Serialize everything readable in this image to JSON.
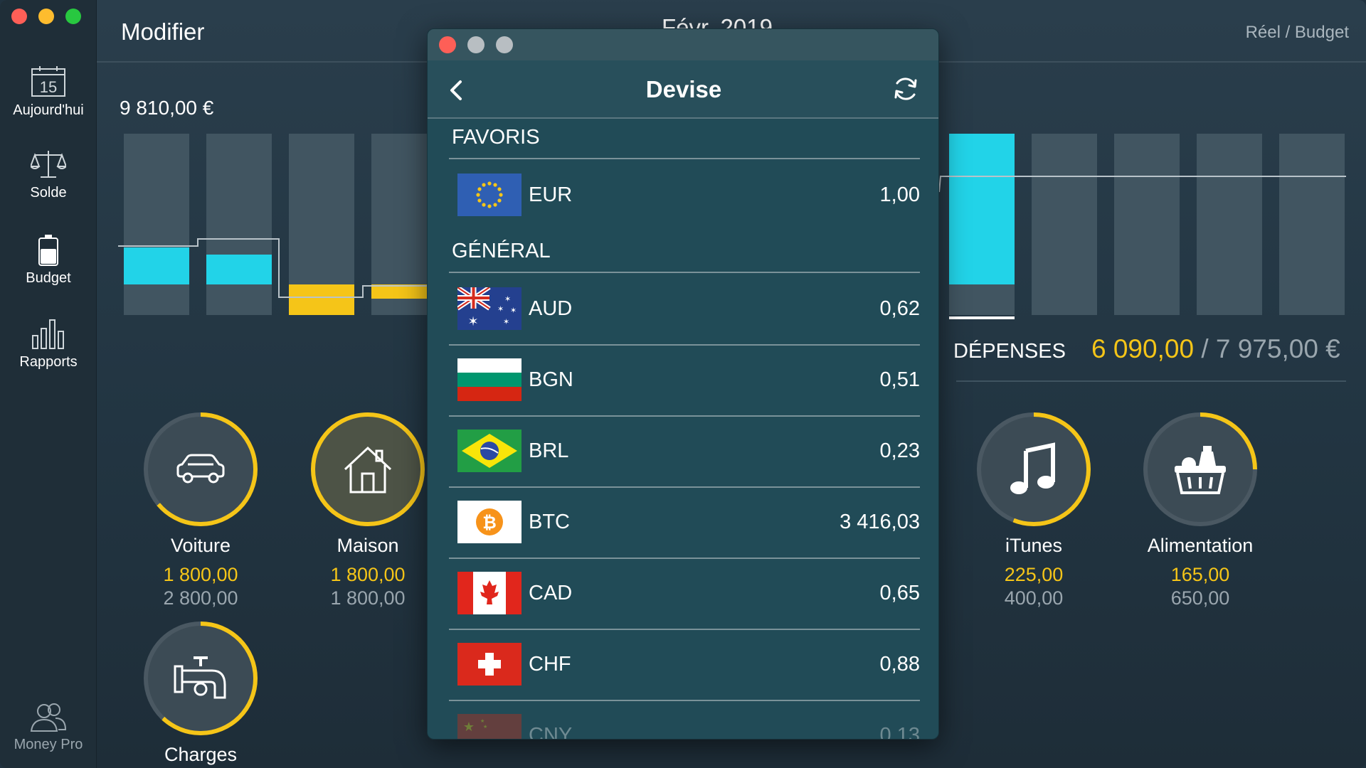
{
  "window": {
    "traffic_lights": [
      "#fe5f57",
      "#febc2e",
      "#28c840"
    ]
  },
  "sidebar": {
    "items": [
      {
        "label": "Aujourd'hui",
        "icon": "calendar-icon",
        "day": "15"
      },
      {
        "label": "Solde",
        "icon": "scale-icon"
      },
      {
        "label": "Budget",
        "icon": "battery-icon"
      },
      {
        "label": "Rapports",
        "icon": "bar-chart-icon"
      }
    ],
    "footer": {
      "label": "Money Pro",
      "icon": "users-icon"
    }
  },
  "header": {
    "title": "Modifier",
    "month": "Févr. 2019",
    "view_toggle": "Réel / Budget"
  },
  "summary": {
    "balance": "9 810,00 €",
    "expenses_label": "DÉPENSES",
    "expenses_spent": "6 090,00",
    "expenses_budget": "/ 7 975,00 €"
  },
  "colors": {
    "accent_yellow": "#f5c518",
    "accent_cyan": "#22d3e8",
    "bar_bg": "#415561"
  },
  "categories": [
    {
      "name": "Voiture",
      "spent": "1 800,00",
      "budget": "2 800,00",
      "icon": "car-icon",
      "progress": 0.64
    },
    {
      "name": "Maison",
      "spent": "1 800,00",
      "budget": "1 800,00",
      "icon": "house-icon",
      "progress": 1.0
    },
    {
      "name": "iTunes",
      "spent": "225,00",
      "budget": "400,00",
      "icon": "music-note-icon",
      "progress": 0.56
    },
    {
      "name": "Alimentation",
      "spent": "165,00",
      "budget": "650,00",
      "icon": "grocery-basket-icon",
      "progress": 0.25
    },
    {
      "name": "Charges",
      "spent": "",
      "budget": "",
      "icon": "water-tap-icon",
      "progress": 0.62
    }
  ],
  "modal": {
    "title": "Devise",
    "back_icon": "chevron-left-icon",
    "refresh_icon": "refresh-icon",
    "favorites_label": "FAVORIS",
    "general_label": "GÉNÉRAL",
    "favorites": [
      {
        "code": "EUR",
        "rate": "1,00",
        "flag": "eu-flag-icon"
      }
    ],
    "currencies": [
      {
        "code": "AUD",
        "rate": "0,62",
        "flag": "australia-flag-icon"
      },
      {
        "code": "BGN",
        "rate": "0,51",
        "flag": "bulgaria-flag-icon"
      },
      {
        "code": "BRL",
        "rate": "0,23",
        "flag": "brazil-flag-icon"
      },
      {
        "code": "BTC",
        "rate": "3 416,03",
        "flag": "bitcoin-icon"
      },
      {
        "code": "CAD",
        "rate": "0,65",
        "flag": "canada-flag-icon"
      },
      {
        "code": "CHF",
        "rate": "0,88",
        "flag": "switzerland-flag-icon"
      },
      {
        "code": "CNY",
        "rate": "0,13",
        "flag": "china-flag-icon"
      }
    ]
  }
}
